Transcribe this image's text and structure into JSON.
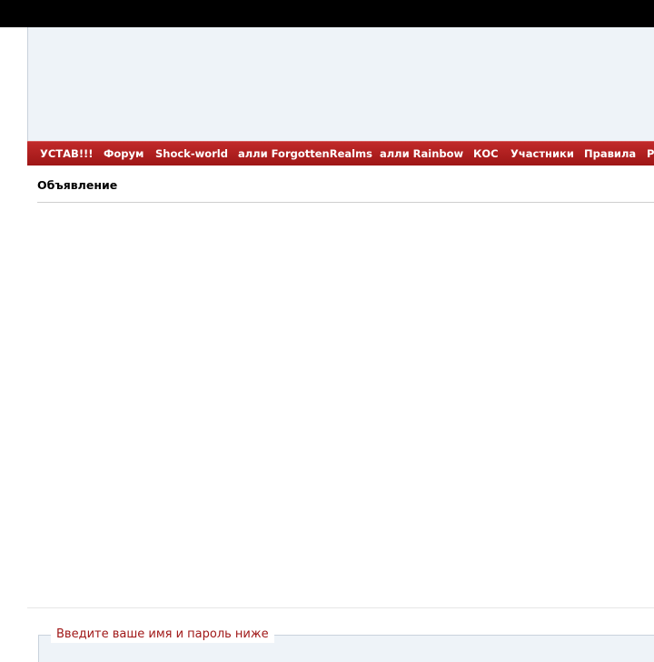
{
  "nav": {
    "items": [
      {
        "label": "УСТАВ!!!"
      },
      {
        "label": "Форум"
      },
      {
        "label": "Shock-world"
      },
      {
        "label": "алли ForgottenRealms"
      },
      {
        "label": "алли Rainbow"
      },
      {
        "label": "КОС"
      },
      {
        "label": "Участники"
      },
      {
        "label": "Правила"
      },
      {
        "label": "Р"
      }
    ]
  },
  "announcement": {
    "title": "Объявление"
  },
  "login": {
    "legend": "Введите ваше имя и пароль ниже"
  },
  "colors": {
    "nav_background": "#b31f1f",
    "header_background": "#eef3f8",
    "legend_text": "#a01818",
    "top_bar": "#000000"
  }
}
